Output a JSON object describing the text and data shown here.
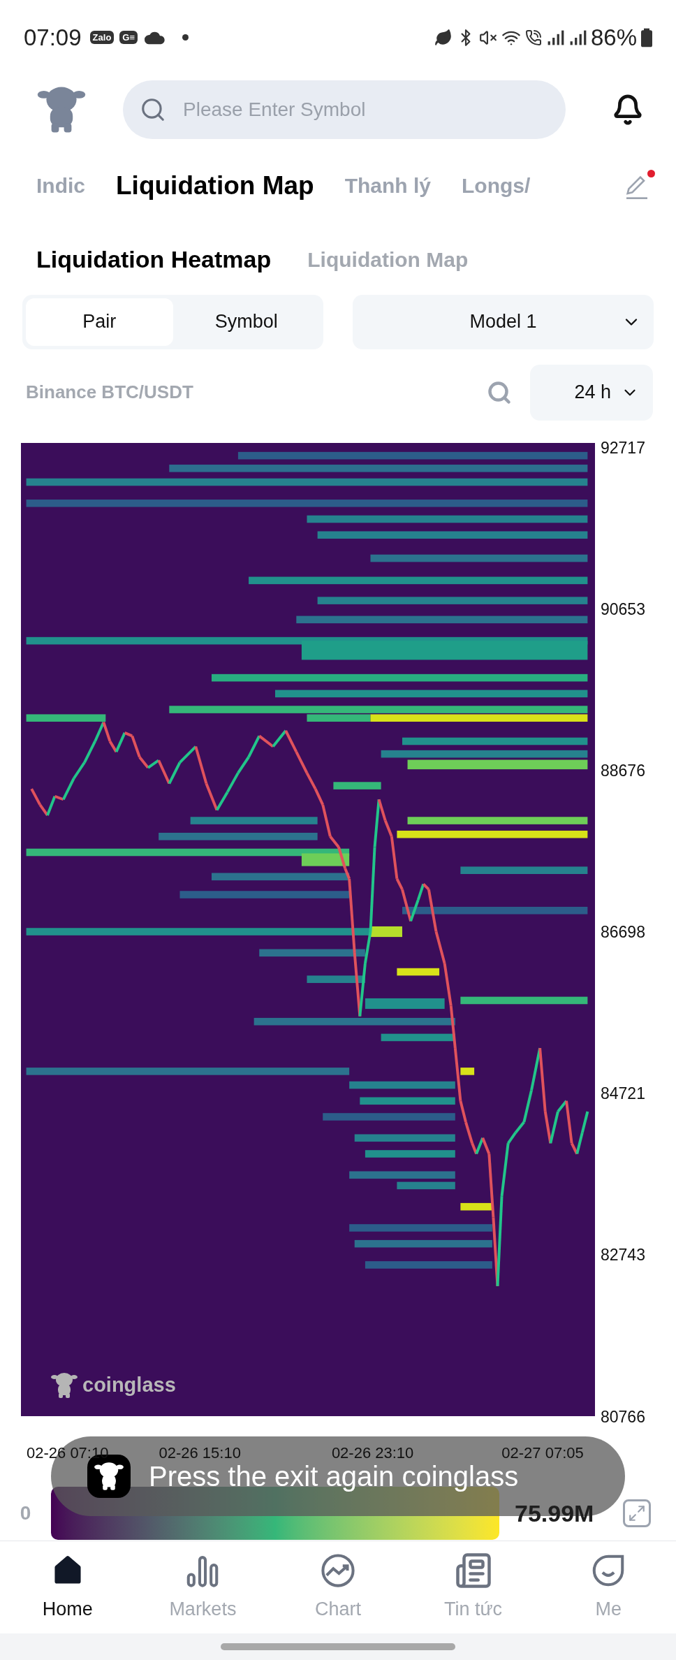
{
  "status_bar": {
    "time": "07:09",
    "notification_badges": [
      "Zalo",
      "G≡"
    ],
    "battery": "86%"
  },
  "header": {
    "search": {
      "placeholder": "Please Enter Symbol"
    }
  },
  "tabs": [
    {
      "label": "Indic",
      "selected": false
    },
    {
      "label": "Liquidation Map",
      "selected": true
    },
    {
      "label": "Thanh lý",
      "selected": false
    },
    {
      "label": "Longs/",
      "selected": false
    }
  ],
  "sub_tabs": [
    {
      "label": "Liquidation Heatmap",
      "selected": true
    },
    {
      "label": "Liquidation Map",
      "selected": false
    }
  ],
  "mode_toggle": [
    {
      "label": "Pair",
      "selected": true
    },
    {
      "label": "Symbol",
      "selected": false
    }
  ],
  "model_select": {
    "value": "Model 1"
  },
  "pair_label": "Binance BTC/USDT",
  "range_select": {
    "value": "24 h"
  },
  "heatmap": {
    "brand": "coinglass",
    "price_labels": [
      "92717",
      "90653",
      "88676",
      "86698",
      "84721",
      "82743",
      "80766"
    ],
    "time_labels": [
      "02-26 07:10",
      "02-26 15:10",
      "02-26 23:10",
      "02-27 07:05"
    ]
  },
  "legend": {
    "min": "0",
    "max": "75.99M"
  },
  "toast": {
    "message": "Press the exit again coinglass"
  },
  "nav": [
    {
      "label": "Home",
      "selected": true
    },
    {
      "label": "Markets",
      "selected": false
    },
    {
      "label": "Chart",
      "selected": false
    },
    {
      "label": "Tin tức",
      "selected": false
    },
    {
      "label": "Me",
      "selected": false
    }
  ]
}
